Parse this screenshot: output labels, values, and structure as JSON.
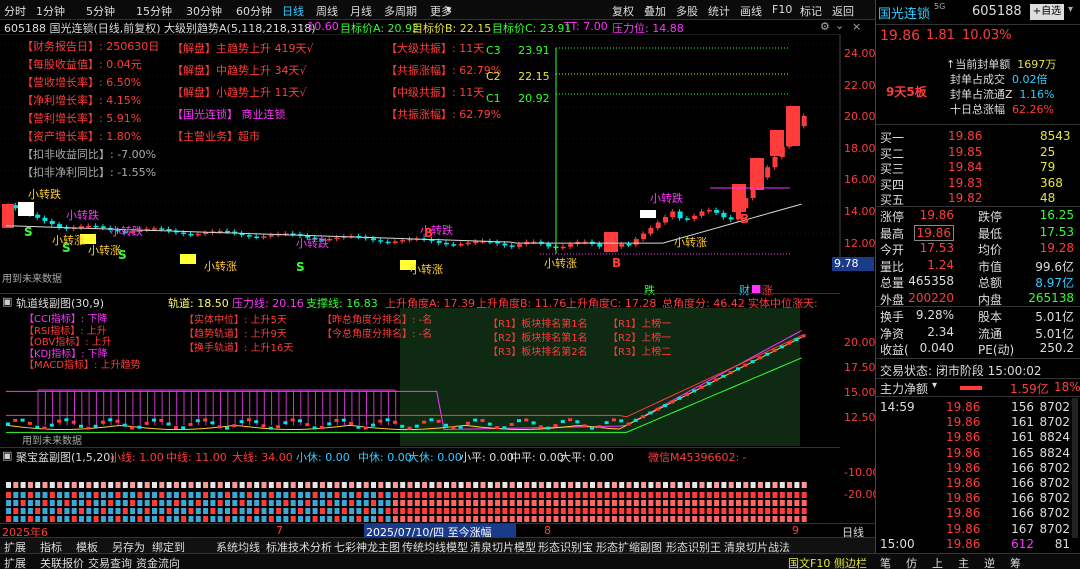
{
  "toolbar": {
    "periods": [
      "分时",
      "1分钟",
      "5分钟",
      "15分钟",
      "30分钟",
      "60分钟",
      "日线",
      "周线",
      "月线",
      "多周期",
      "更多"
    ],
    "active": "日线",
    "right": [
      "复权",
      "叠加",
      "多股",
      "统计",
      "画线",
      "F10",
      "标记",
      "返回"
    ]
  },
  "main_header": {
    "title": "605188 国光连锁(日线,前复权)",
    "ind": "大级别趋势A(5,118,218,318)",
    "v1": ": 10.60",
    "target_a": "目标价A: 20.92",
    "target_b": "目标价B: 22.15",
    "target_c": "目标价C: 23.91",
    "tt": "TT: 7.00",
    "pressure": "压力位: 14.88"
  },
  "info_left": [
    "【财务报告日】: 250630日",
    "【每股收益值】: 0.04元",
    "【营收增长率】: 6.50%",
    "【净利增长率】: 4.15%",
    "【营利增长率】: 5.91%",
    "【资产增长率】: 1.80%",
    "【扣非收益同比】: -7.00%",
    "【扣非净利同比】: -1.55%"
  ],
  "info_mid": [
    "【解盘】主趋势上升 419天√",
    "【解盘】中趋势上升 34天√",
    "【解盘】小趋势上升 11天√",
    "【国光连锁】 商业连锁",
    "【主营业务】超市"
  ],
  "info_right": [
    "【大级共振】: 11天",
    "【共振涨幅】: 62.79%",
    "【中级共振】: 11天",
    "【共振涨幅】: 62.79%"
  ],
  "targets": {
    "c3": "C3",
    "c3v": "23.91",
    "c2": "C2",
    "c2v": "22.15",
    "c1": "C1",
    "c1v": "20.92"
  },
  "y_axis_main": [
    "24.00",
    "22.00",
    "20.00",
    "18.00",
    "16.00",
    "14.00",
    "12.00"
  ],
  "price_tag": "9.78",
  "chart_labels": {
    "s": "S",
    "b": "B",
    "xzd": "小转跌",
    "xzz": "小转涨",
    "yong": "用到未来数据",
    "die": "跌",
    "cai": "财",
    "zhang": "涨"
  },
  "sub1_header": {
    "title": "轨道线副图(30,9)",
    "track": "轨道: 18.50",
    "press": "压力线: 20.16",
    "support": "支撑线: 16.83",
    "angA": "上升角度A: 17.39",
    "angB": "上升角度B: 11.76",
    "angC": "上升角度C: 17.28",
    "angT": "总角度分: 46.42",
    "ent": "实体中位涨天: 5.00"
  },
  "sub1_info_a": [
    "【CCI指标】: 下降",
    "【RSI指标】: 上升",
    "【OBV指标】: 上升",
    "【KDJ指标】: 下降",
    "【MACD指标】: 上升趋势"
  ],
  "sub1_info_b": [
    "【实体中位】: 上升5天",
    "【趋势轨道】: 上升9天",
    "【换手轨道】: 上升16天"
  ],
  "sub1_info_c": [
    "【昨总角度分排名】: -名",
    "【今总角度分排名】: -名"
  ],
  "sub1_info_d": [
    "【R1】板块排名第1名",
    "【R2】板块排名第1名",
    "【R3】板块排名第2名"
  ],
  "sub1_info_e": [
    "【R1】上榜一",
    "【R2】上榜一",
    "【R3】上榜二"
  ],
  "y_axis_sub1": [
    "20.00",
    "17.50",
    "15.00",
    "12.50"
  ],
  "sub2_header": {
    "title": "聚宝盆副图(1,5,20)",
    "xl": "小线: 1.00",
    "zl": "中线: 11.00",
    "dl": "大线: 34.00",
    "xx": "小休: 0.00",
    "zx": "中休: 0.00",
    "dx": "大休: 0.00",
    "xp": "小平: 0.00",
    "zp": "中平: 0.00",
    "dp": "大平: 0.00",
    "wx": "微信M45396602: -"
  },
  "y_axis_sub2": [
    "-10.00",
    "-20.00"
  ],
  "xaxis": {
    "y2025": "2025年6",
    "m7": "7",
    "m8": "8",
    "m9": "9",
    "date": "2025/07/10/四",
    "pct": "至今涨幅81.54%",
    "period": "日线"
  },
  "bottom_tabs": [
    "扩展",
    "指标",
    "模板",
    "另存为",
    "绑定到",
    "系统均线",
    "标准技术分析",
    "七彩神龙主图",
    "传统均线模型",
    "清泉切片模型",
    "形态识别宝",
    "形态扩缩副图",
    "形态识别王",
    "清泉切片战法"
  ],
  "status_bar": [
    "扩展",
    "关联报价",
    "交易查询",
    "资金流向"
  ],
  "status_right": [
    "国文F10",
    "侧边栏",
    "笔",
    "仿",
    "上",
    "主",
    "逆",
    "筹"
  ],
  "quote": {
    "name": "国光连锁",
    "code": "605188",
    "self": "+自选",
    "price": "19.86",
    "chg": "1.81",
    "pct": "10.03%",
    "seal_title": "当前封单额",
    "seal_amount": "1697万",
    "seal_l1": "封单占成交",
    "seal_v1": "0.02倍",
    "seal_l2": "封单占流通Z",
    "seal_v2": "1.16%",
    "seal_l3": "十日总涨幅",
    "seal_v3": "62.26%",
    "board": "9天5板"
  },
  "orderbook": [
    {
      "label": "买一",
      "price": "19.86",
      "vol": "8543"
    },
    {
      "label": "买二",
      "price": "19.85",
      "vol": "25"
    },
    {
      "label": "买三",
      "price": "19.84",
      "vol": "79"
    },
    {
      "label": "买四",
      "price": "19.83",
      "vol": "368"
    },
    {
      "label": "买五",
      "price": "19.82",
      "vol": "48"
    }
  ],
  "stats": [
    {
      "l1": "涨停",
      "v1": "19.86",
      "l2": "跌停",
      "v2": "16.25"
    },
    {
      "l1": "最高",
      "v1": "19.86",
      "l2": "最低",
      "v2": "17.53"
    },
    {
      "l1": "今开",
      "v1": "17.53",
      "l2": "均价",
      "v2": "19.28"
    },
    {
      "l1": "量比",
      "v1": "1.24",
      "l2": "市值",
      "v2": "99.6亿"
    },
    {
      "l1": "总量",
      "v1": "465358",
      "l2": "总额",
      "v2": "8.97亿"
    },
    {
      "l1": "外盘",
      "v1": "200220",
      "l2": "内盘",
      "v2": "265138"
    }
  ],
  "stats2": [
    {
      "l1": "换手",
      "v1": "9.28%",
      "l2": "股本",
      "v2": "5.01亿"
    },
    {
      "l1": "净资",
      "v1": "2.34",
      "l2": "流通",
      "v2": "5.01亿"
    },
    {
      "l1": "收益(",
      "v1": "0.040",
      "l2": "PE(动)",
      "v2": "250.2"
    }
  ],
  "trade_state": "交易状态: 闭市阶段 15:00:02",
  "main_net": {
    "label": "主力净额",
    "val": "1.59亿",
    "pct": "18%"
  },
  "ticks": [
    {
      "t": "14:59",
      "p": "19.86",
      "v": "156",
      "n": "8702"
    },
    {
      "t": "",
      "p": "19.86",
      "v": "161",
      "n": "8702"
    },
    {
      "t": "",
      "p": "19.86",
      "v": "161",
      "n": "8824"
    },
    {
      "t": "",
      "p": "19.86",
      "v": "165",
      "n": "8824"
    },
    {
      "t": "",
      "p": "19.86",
      "v": "166",
      "n": "8702"
    },
    {
      "t": "",
      "p": "19.86",
      "v": "166",
      "n": "8702"
    },
    {
      "t": "",
      "p": "19.86",
      "v": "166",
      "n": "8702"
    },
    {
      "t": "",
      "p": "19.86",
      "v": "166",
      "n": "8702"
    },
    {
      "t": "",
      "p": "19.86",
      "v": "167",
      "n": "8702"
    },
    {
      "t": "15:00",
      "p": "19.86",
      "v": "612",
      "n": "81"
    }
  ],
  "colors": {
    "up": "#ff3c3c",
    "down": "#00e5e5",
    "ma": "#f3f3f3",
    "target": "#e6e63a"
  }
}
